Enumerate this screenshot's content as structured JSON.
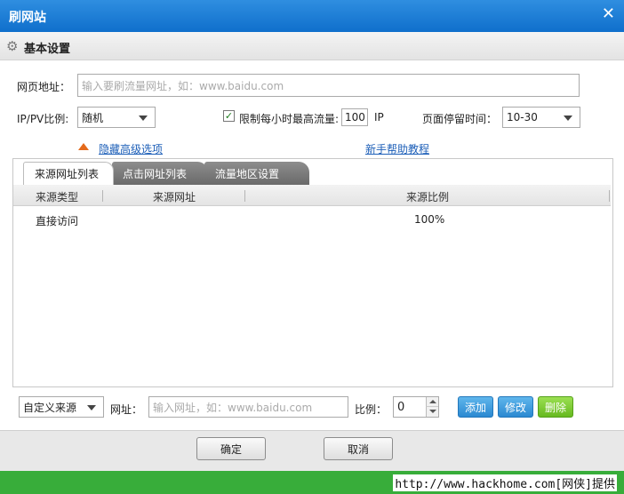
{
  "window": {
    "title": "刷网站",
    "close_glyph": "✕"
  },
  "section": {
    "title": "基本设置",
    "icon": "gear-icon"
  },
  "url_field": {
    "label": "网页地址：",
    "placeholder": "输入要刷流量网址，如：www.baidu.com"
  },
  "ratio": {
    "label": "IP/PV比例:",
    "value": "随机"
  },
  "limit": {
    "checked": true,
    "check_glyph": "✓",
    "label": "限制每小时最高流量:",
    "value": "100",
    "unit": "IP"
  },
  "stay_time": {
    "label": "页面停留时间：",
    "value": "10-30"
  },
  "links": {
    "hide_advanced": "隐藏高级选项",
    "help": "新手帮助教程"
  },
  "tabs": [
    {
      "label": "来源网址列表",
      "active": true
    },
    {
      "label": "点击网址列表",
      "active": false
    },
    {
      "label": "流量地区设置",
      "active": false
    }
  ],
  "table": {
    "columns": [
      "来源类型",
      "来源网址",
      "来源比例"
    ],
    "rows": [
      {
        "type": "直接访问",
        "url": "",
        "ratio": "100%"
      }
    ]
  },
  "bottom": {
    "source_select": "自定义来源",
    "url_label": "网址：",
    "url_placeholder": "输入网址，如：www.baidu.com",
    "ratio_label": "比例：",
    "ratio_value": "0",
    "add": "添加",
    "edit": "修改",
    "delete": "删除"
  },
  "footer": {
    "ok": "确定",
    "cancel": "取消"
  },
  "credit": "http://www.hackhome.com[网侠]提供",
  "colors": {
    "title_bar": "#1a7ed6",
    "accent_blue": "#2b89d1",
    "accent_green": "#66b91f",
    "link": "#1d5fb8"
  }
}
